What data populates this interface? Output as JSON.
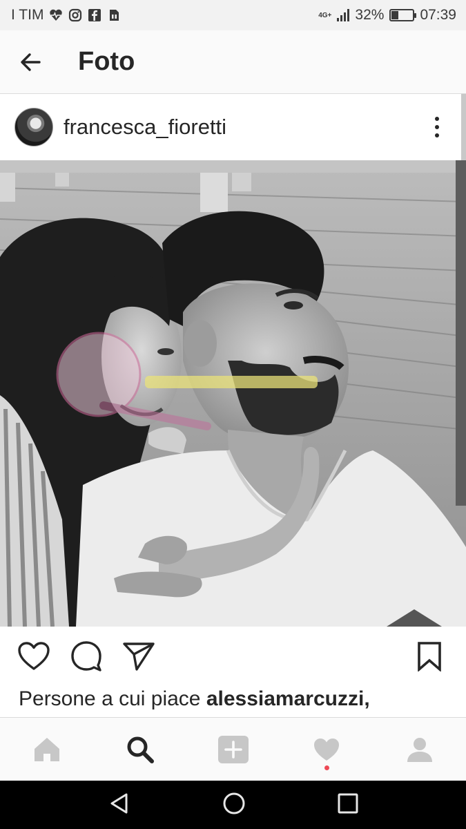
{
  "status_bar": {
    "carrier": "I TIM",
    "network": "4G+",
    "battery": "32%",
    "battery_level": 0.32,
    "time": "07:39",
    "icons": [
      "heart-monitor-icon",
      "instagram-icon",
      "facebook-icon",
      "sim-card-icon",
      "signal-icon",
      "battery-icon"
    ]
  },
  "header": {
    "title": "Foto",
    "back_icon": "arrow-left-icon"
  },
  "post": {
    "username": "francesca_fioretti",
    "more_icon": "vertical-dots-icon",
    "photo_alt": "photo"
  },
  "actions": {
    "icons": [
      "heart-icon",
      "comment-icon",
      "share-icon",
      "bookmark-icon"
    ]
  },
  "likes": {
    "prefix": "Persone a cui piace ",
    "first_user": "alessiamarcuzzi,"
  },
  "bottom_nav": {
    "items": [
      "home-icon",
      "search-icon",
      "add-icon",
      "activity-heart-icon",
      "profile-icon"
    ],
    "active": "search-icon",
    "notification_dot_color": "#ed4956"
  },
  "android_nav": {
    "items": [
      "back-triangle-icon",
      "home-circle-icon",
      "recents-square-icon"
    ]
  },
  "colors": {
    "text": "#262626",
    "icon_inactive": "#c7c7c7",
    "background": "#fafafa"
  }
}
